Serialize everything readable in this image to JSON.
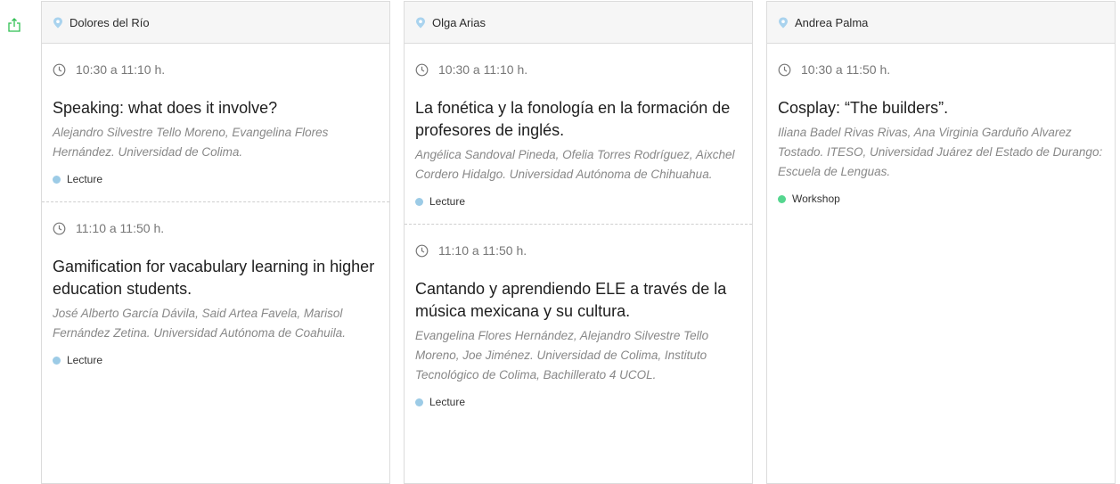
{
  "colors": {
    "lecture": "#9ccbe6",
    "workshop": "#55d68f",
    "accent_green": "#2fbf52",
    "pin": "#a9d3ee"
  },
  "icons": {
    "export": "export-icon",
    "location": "location-pin-icon",
    "time": "clock-icon"
  },
  "columns": [
    {
      "room": "Dolores del Río",
      "sessions": [
        {
          "time": "10:30 a 11:10 h.",
          "title": "Speaking: what does it involve?",
          "authors": "Alejandro Silvestre Tello Moreno, Evangelina Flores Hernández. Universidad de Colima.",
          "type": "Lecture"
        },
        {
          "time": "11:10 a 11:50 h.",
          "title": "Gamification for vacabulary learning in higher education students.",
          "authors": "José Alberto García Dávila, Said Artea Favela, Marisol Fernández Zetina. Universidad Autónoma de Coahuila.",
          "type": "Lecture"
        }
      ]
    },
    {
      "room": "Olga Arias",
      "sessions": [
        {
          "time": "10:30 a 11:10 h.",
          "title": "La fonética y la fonología en la formación de profesores de inglés.",
          "authors": "Angélica Sandoval Pineda, Ofelia Torres Rodríguez, Aixchel Cordero Hidalgo. Universidad Autónoma de Chihuahua.",
          "type": "Lecture"
        },
        {
          "time": "11:10 a 11:50 h.",
          "title": "Cantando y aprendiendo ELE a través de la música mexicana y su cultura.",
          "authors": "Evangelina Flores Hernández, Alejandro Silvestre Tello Moreno, Joe Jiménez. Universidad de Colima, Instituto Tecnológico de Colima, Bachillerato 4 UCOL.",
          "type": "Lecture"
        }
      ]
    },
    {
      "room": "Andrea Palma",
      "sessions": [
        {
          "time": "10:30 a 11:50 h.",
          "title": "Cosplay: “The builders”.",
          "authors": "Iliana Badel Rivas Rivas, Ana Virginia Garduño Alvarez Tostado. ITESO, Universidad Juárez del Estado de Durango: Escuela de Lenguas.",
          "type": "Workshop"
        }
      ]
    }
  ]
}
